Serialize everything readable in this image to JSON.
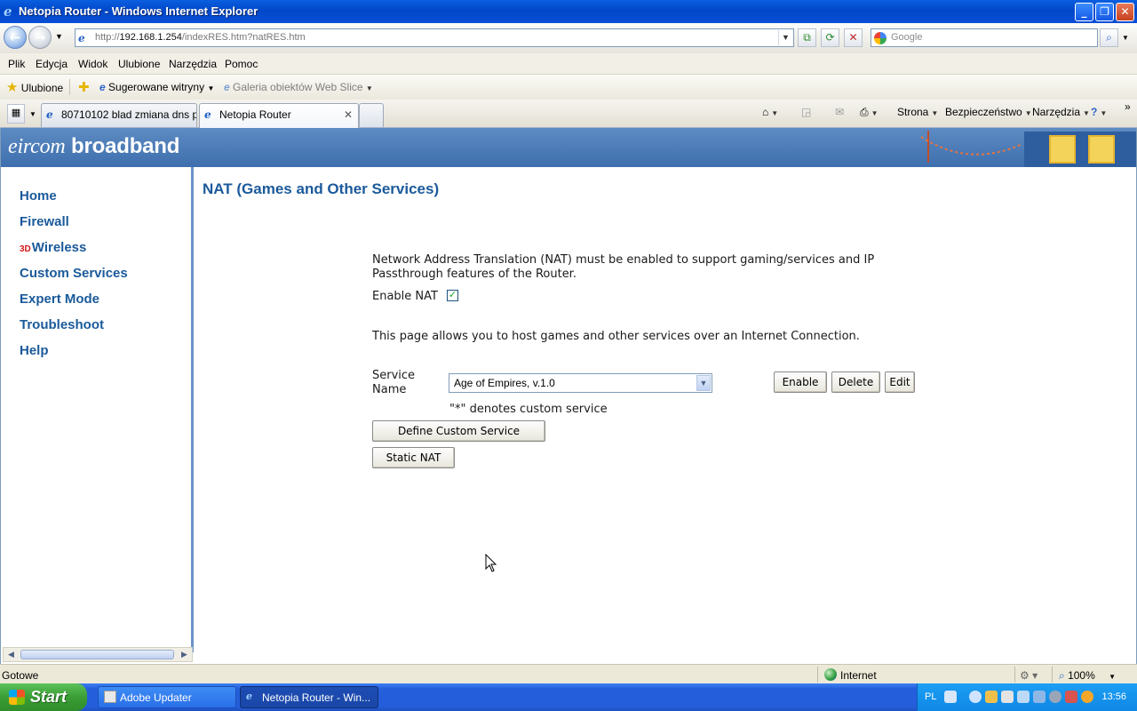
{
  "window": {
    "title": "Netopia Router - Windows Internet Explorer"
  },
  "browser": {
    "url_prefix": "http://",
    "url_host": "192.168.1.254",
    "url_path": "/indexRES.htm?natRES.htm",
    "search_placeholder": "Google",
    "menu": [
      "Plik",
      "Edycja",
      "Widok",
      "Ulubione",
      "Narzędzia",
      "Pomoc"
    ],
    "favorites": {
      "label": "Ulubione",
      "suggested": "Sugerowane witryny",
      "gallery": "Galeria obiektów Web Slice"
    },
    "tabs": [
      {
        "label": "80710102 blad zmiana dns p...",
        "active": false
      },
      {
        "label": "Netopia Router",
        "active": true
      }
    ],
    "commands": [
      "Strona",
      "Bezpieczeństwo",
      "Narzędzia"
    ]
  },
  "page": {
    "brand_italic": "eircom",
    "brand_bold": "broadband",
    "nav": [
      "Home",
      "Firewall",
      "Wireless",
      "Custom Services",
      "Expert Mode",
      "Troubleshoot",
      "Help"
    ],
    "title": "NAT (Games and Other Services)",
    "intro_line1": "Network Address Translation (NAT) must be enabled to support gaming/services and IP",
    "intro_line2": "Passthrough features of the Router.",
    "enable_nat_label": "Enable NAT",
    "enable_nat_checked": true,
    "host_text": "This page allows you to host games and other services over an Internet Connection.",
    "service_label_1": "Service",
    "service_label_2": "Name",
    "service_selected": "Age of Empires, v.1.0",
    "custom_note": "\"*\" denotes custom service",
    "buttons": {
      "enable": "Enable",
      "delete": "Delete",
      "edit": "Edit",
      "define": "Define Custom Service",
      "static_nat": "Static NAT"
    }
  },
  "status": {
    "text": "Gotowe",
    "zone": "Internet",
    "zoom": "100%"
  },
  "taskbar": {
    "start": "Start",
    "tasks": [
      {
        "label": "Adobe Updater",
        "active": false
      },
      {
        "label": "Netopia Router - Win...",
        "active": true
      }
    ],
    "lang": "PL",
    "clock": "13:56"
  }
}
